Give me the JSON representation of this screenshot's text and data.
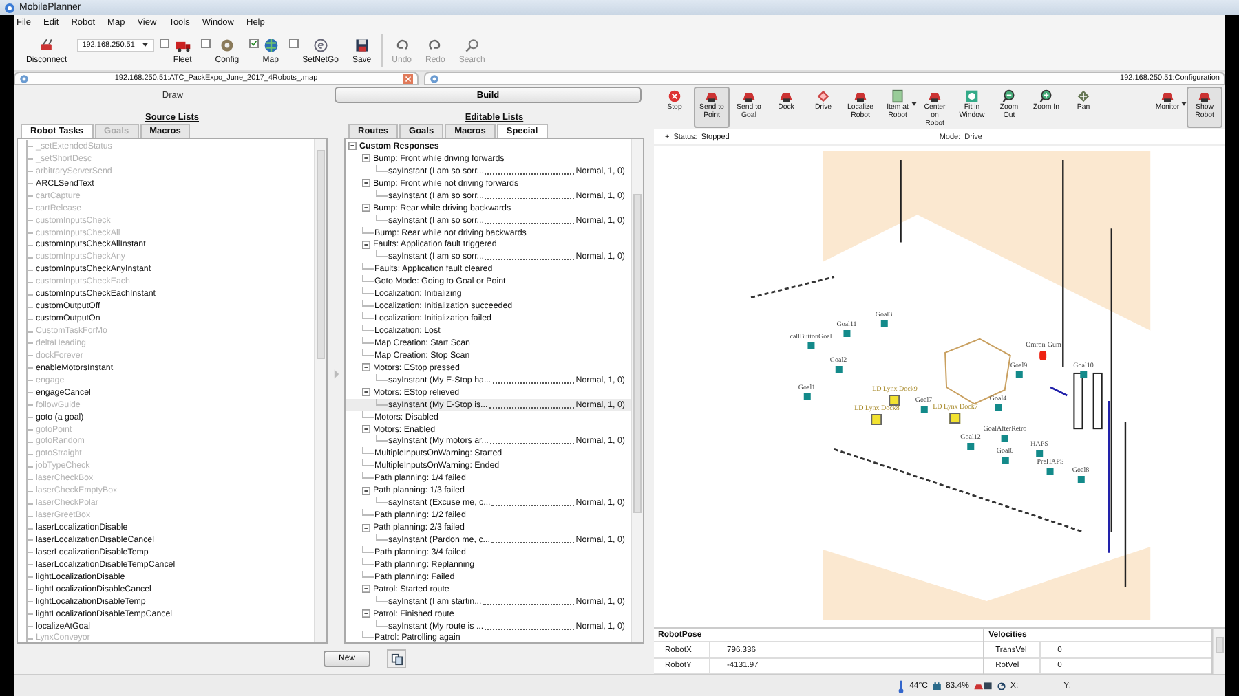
{
  "window": {
    "title": "MobilePlanner"
  },
  "menu": [
    "File",
    "Edit",
    "Robot",
    "Map",
    "View",
    "Tools",
    "Window",
    "Help"
  ],
  "toolbar": [
    {
      "kind": "button",
      "label": "Disconnect",
      "disabled": false
    },
    {
      "kind": "combo",
      "value": "192.168.250.51"
    },
    {
      "kind": "check",
      "label": "Fleet",
      "checked": false,
      "disabled": false
    },
    {
      "kind": "check",
      "label": "Config",
      "checked": false,
      "disabled": false
    },
    {
      "kind": "check",
      "label": "Map",
      "checked": true,
      "disabled": false
    },
    {
      "kind": "check",
      "label": "SetNetGo",
      "checked": false,
      "disabled": false
    },
    {
      "kind": "button",
      "label": "Save",
      "disabled": false
    },
    {
      "kind": "button",
      "label": "Undo",
      "disabled": true
    },
    {
      "kind": "button",
      "label": "Redo",
      "disabled": true
    },
    {
      "kind": "button",
      "label": "Search",
      "disabled": true
    }
  ],
  "document_tabs": [
    {
      "label": "192.168.250.51:ATC_PackExpo_June_2017_4Robots_.map",
      "selected": true
    },
    {
      "label": "192.168.250.51:Configuration",
      "selected": false
    }
  ],
  "mode_switch": [
    {
      "label": "Draw",
      "selected": false
    },
    {
      "label": "Build",
      "selected": true
    }
  ],
  "source_lists": {
    "heading": "Source Lists",
    "tabs": [
      {
        "label": "Robot Tasks",
        "selected": true,
        "disabled": false
      },
      {
        "label": "Goals",
        "selected": false,
        "disabled": true
      },
      {
        "label": "Macros",
        "selected": false,
        "disabled": false
      }
    ],
    "items": [
      {
        "label": "_setExtendedStatus",
        "enabled": false
      },
      {
        "label": "_setShortDesc",
        "enabled": false
      },
      {
        "label": "arbitraryServerSend",
        "enabled": false
      },
      {
        "label": "ARCLSendText",
        "enabled": true
      },
      {
        "label": "cartCapture",
        "enabled": false
      },
      {
        "label": "cartRelease",
        "enabled": false
      },
      {
        "label": "customInputsCheck",
        "enabled": false
      },
      {
        "label": "customInputsCheckAll",
        "enabled": false
      },
      {
        "label": "customInputsCheckAllInstant",
        "enabled": true
      },
      {
        "label": "customInputsCheckAny",
        "enabled": false
      },
      {
        "label": "customInputsCheckAnyInstant",
        "enabled": true
      },
      {
        "label": "customInputsCheckEach",
        "enabled": false
      },
      {
        "label": "customInputsCheckEachInstant",
        "enabled": true
      },
      {
        "label": "customOutputOff",
        "enabled": true
      },
      {
        "label": "customOutputOn",
        "enabled": true
      },
      {
        "label": "CustomTaskForMo",
        "enabled": false
      },
      {
        "label": "deltaHeading",
        "enabled": false
      },
      {
        "label": "dockForever",
        "enabled": false
      },
      {
        "label": "enableMotorsInstant",
        "enabled": true
      },
      {
        "label": "engage",
        "enabled": false
      },
      {
        "label": "engageCancel",
        "enabled": true
      },
      {
        "label": "followGuide",
        "enabled": false
      },
      {
        "label": "goto (a goal)",
        "enabled": true
      },
      {
        "label": "gotoPoint",
        "enabled": false
      },
      {
        "label": "gotoRandom",
        "enabled": false
      },
      {
        "label": "gotoStraight",
        "enabled": false
      },
      {
        "label": "jobTypeCheck",
        "enabled": false
      },
      {
        "label": "laserCheckBox",
        "enabled": false
      },
      {
        "label": "laserCheckEmptyBox",
        "enabled": false
      },
      {
        "label": "laserCheckPolar",
        "enabled": false
      },
      {
        "label": "laserGreetBox",
        "enabled": false
      },
      {
        "label": "laserLocalizationDisable",
        "enabled": true
      },
      {
        "label": "laserLocalizationDisableCancel",
        "enabled": true
      },
      {
        "label": "laserLocalizationDisableTemp",
        "enabled": true
      },
      {
        "label": "laserLocalizationDisableTempCancel",
        "enabled": true
      },
      {
        "label": "lightLocalizationDisable",
        "enabled": true
      },
      {
        "label": "lightLocalizationDisableCancel",
        "enabled": true
      },
      {
        "label": "lightLocalizationDisableTemp",
        "enabled": true
      },
      {
        "label": "lightLocalizationDisableTempCancel",
        "enabled": true
      },
      {
        "label": "localizeAtGoal",
        "enabled": true
      },
      {
        "label": "LynxConveyor",
        "enabled": false
      }
    ]
  },
  "editable_lists": {
    "heading": "Editable Lists",
    "tabs": [
      {
        "label": "Routes",
        "selected": false
      },
      {
        "label": "Goals",
        "selected": false
      },
      {
        "label": "Macros",
        "selected": false
      },
      {
        "label": "Special",
        "selected": true
      }
    ],
    "tree": [
      {
        "label": "Custom Responses",
        "expanded": true,
        "selected": false,
        "children": [
          {
            "label": "Bump: Front while driving forwards",
            "expanded": true,
            "selected": false,
            "children": [
              {
                "label": "sayInstant (I am so sorr...",
                "value": "Normal, 1, 0)",
                "selected": false
              }
            ]
          },
          {
            "label": "Bump: Front while not driving forwards",
            "expanded": true,
            "selected": false,
            "children": [
              {
                "label": "sayInstant (I am so sorr...",
                "value": "Normal, 1, 0)",
                "selected": false
              }
            ]
          },
          {
            "label": "Bump: Rear while driving backwards",
            "expanded": true,
            "selected": false,
            "children": [
              {
                "label": "sayInstant (I am so sorr...",
                "value": "Normal, 1, 0)",
                "selected": false
              }
            ]
          },
          {
            "label": "Bump: Rear while not driving backwards",
            "selected": false
          },
          {
            "label": "Faults: Application fault triggered",
            "expanded": true,
            "selected": false,
            "children": [
              {
                "label": "sayInstant (I am so sorr...",
                "value": "Normal, 1, 0)",
                "selected": false
              }
            ]
          },
          {
            "label": "Faults: Application fault cleared",
            "selected": false
          },
          {
            "label": "Goto Mode: Going to Goal or Point",
            "selected": false
          },
          {
            "label": "Localization: Initializing",
            "selected": false
          },
          {
            "label": "Localization: Initialization succeeded",
            "selected": false
          },
          {
            "label": "Localization: Initialization failed",
            "selected": false
          },
          {
            "label": "Localization: Lost",
            "selected": false
          },
          {
            "label": "Map Creation: Start Scan",
            "selected": false
          },
          {
            "label": "Map Creation: Stop Scan",
            "selected": false
          },
          {
            "label": "Motors: EStop pressed",
            "expanded": true,
            "selected": false,
            "children": [
              {
                "label": "sayInstant (My E-Stop ha...",
                "value": "Normal, 1, 0)",
                "selected": false
              }
            ]
          },
          {
            "label": "Motors: EStop relieved",
            "expanded": true,
            "selected": false,
            "children": [
              {
                "label": "sayInstant (My E-Stop is...",
                "value": "Normal, 1, 0)",
                "selected": true
              }
            ]
          },
          {
            "label": "Motors: Disabled",
            "selected": false
          },
          {
            "label": "Motors: Enabled",
            "expanded": true,
            "selected": false,
            "children": [
              {
                "label": "sayInstant (My motors ar...",
                "value": "Normal, 1, 0)",
                "selected": false
              }
            ]
          },
          {
            "label": "MultipleInputsOnWarning: Started",
            "selected": false
          },
          {
            "label": "MultipleInputsOnWarning: Ended",
            "selected": false
          },
          {
            "label": "Path planning: 1/4 failed",
            "selected": false
          },
          {
            "label": "Path planning: 1/3 failed",
            "expanded": true,
            "selected": false,
            "children": [
              {
                "label": "sayInstant (Excuse me, c...",
                "value": "Normal, 1, 0)",
                "selected": false
              }
            ]
          },
          {
            "label": "Path planning: 1/2 failed",
            "selected": false
          },
          {
            "label": "Path planning: 2/3 failed",
            "expanded": true,
            "selected": false,
            "children": [
              {
                "label": "sayInstant (Pardon me, c...",
                "value": "Normal, 1, 0)",
                "selected": false
              }
            ]
          },
          {
            "label": "Path planning: 3/4 failed",
            "selected": false
          },
          {
            "label": "Path planning: Replanning",
            "selected": false
          },
          {
            "label": "Path planning: Failed",
            "selected": false
          },
          {
            "label": "Patrol: Started route",
            "expanded": true,
            "selected": false,
            "children": [
              {
                "label": "sayInstant (I am startin...",
                "value": "Normal, 1, 0)",
                "selected": false
              }
            ]
          },
          {
            "label": "Patrol: Finished route",
            "expanded": true,
            "selected": false,
            "children": [
              {
                "label": "sayInstant (My route is ...",
                "value": "Normal, 1, 0)",
                "selected": false
              }
            ]
          },
          {
            "label": "Patrol: Patrolling again",
            "selected": false
          }
        ]
      }
    ]
  },
  "list_buttons": {
    "new_label": "New"
  },
  "map_toolbar": [
    {
      "label": "Stop",
      "selected": false,
      "dropdown": false
    },
    {
      "label": "Send to Point",
      "selected": true,
      "dropdown": false
    },
    {
      "label": "Send to Goal",
      "selected": false,
      "dropdown": false
    },
    {
      "label": "Dock",
      "selected": false,
      "dropdown": false
    },
    {
      "label": "Drive",
      "selected": false,
      "dropdown": false
    },
    {
      "label": "Localize Robot",
      "selected": false,
      "dropdown": false
    },
    {
      "label": "Item at Robot",
      "selected": false,
      "dropdown": true
    },
    {
      "label": "Center on Robot",
      "selected": false,
      "dropdown": false
    },
    {
      "label": "Fit in Window",
      "selected": false,
      "dropdown": false
    },
    {
      "label": "Zoom Out",
      "selected": false,
      "dropdown": false
    },
    {
      "label": "Zoom In",
      "selected": false,
      "dropdown": false
    },
    {
      "label": "Pan",
      "selected": false,
      "dropdown": false
    },
    {
      "label": "Monitor",
      "selected": false,
      "dropdown": true
    },
    {
      "label": "Show Robot",
      "selected": true,
      "dropdown": false
    }
  ],
  "map_status": {
    "expander": "+",
    "status_label": "Status:",
    "status": "Stopped",
    "mode_label": "Mode:",
    "mode": "Drive"
  },
  "map": {
    "markers": [
      {
        "label": "Goal11",
        "kind": "goal"
      },
      {
        "label": "Goal3",
        "kind": "goal"
      },
      {
        "label": "callButtonGoal",
        "kind": "goal"
      },
      {
        "label": "Goal2",
        "kind": "goal"
      },
      {
        "label": "Goal1",
        "kind": "goal"
      },
      {
        "label": "LD Lynx Dock9",
        "kind": "dock"
      },
      {
        "label": "Goal7",
        "kind": "goal"
      },
      {
        "label": "LD Lynx Dock8",
        "kind": "dock"
      },
      {
        "label": "LD Lynx Dock7",
        "kind": "dock"
      },
      {
        "label": "Goal4",
        "kind": "goal"
      },
      {
        "label": "Goal9",
        "kind": "goal"
      },
      {
        "label": "Omron-Gum",
        "kind": "robot"
      },
      {
        "label": "Goal10",
        "kind": "goal"
      },
      {
        "label": "GoalAfterRetro",
        "kind": "goal"
      },
      {
        "label": "Goal12",
        "kind": "goal"
      },
      {
        "label": "HAPS",
        "kind": "goal"
      },
      {
        "label": "Goal6",
        "kind": "goal"
      },
      {
        "label": "PreHAPS",
        "kind": "goal"
      },
      {
        "label": "Goal8",
        "kind": "goal"
      }
    ]
  },
  "robot_pose": {
    "title": "RobotPose",
    "rows": [
      {
        "name": "RobotX",
        "value": "796.336"
      },
      {
        "name": "RobotY",
        "value": "-4131.97"
      }
    ]
  },
  "velocities": {
    "title": "Velocities",
    "rows": [
      {
        "name": "TransVel",
        "value": "0"
      },
      {
        "name": "RotVel",
        "value": "0"
      }
    ]
  },
  "status_bar": {
    "temperature": "44°C",
    "battery": "83.4%",
    "x_label": "X:",
    "y_label": "Y:"
  }
}
